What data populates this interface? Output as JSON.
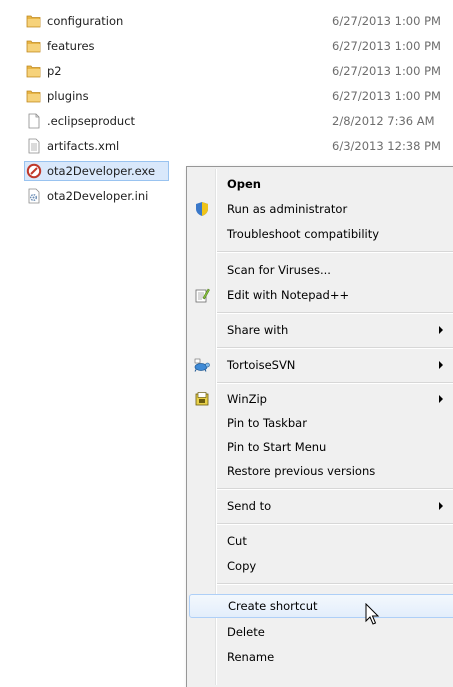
{
  "files": [
    {
      "name": "configuration",
      "date": "6/27/2013 1:00 PM",
      "icon": "folder-icon"
    },
    {
      "name": "features",
      "date": "6/27/2013 1:00 PM",
      "icon": "folder-icon"
    },
    {
      "name": "p2",
      "date": "6/27/2013 1:00 PM",
      "icon": "folder-icon"
    },
    {
      "name": "plugins",
      "date": "6/27/2013 1:00 PM",
      "icon": "folder-icon"
    },
    {
      "name": ".eclipseproduct",
      "date": "2/8/2012 7:36 AM",
      "icon": "blank-file-icon"
    },
    {
      "name": "artifacts.xml",
      "date": "6/3/2013 12:38 PM",
      "icon": "text-file-icon"
    },
    {
      "name": "ota2Developer.exe",
      "date": "",
      "icon": "exe-icon"
    },
    {
      "name": "ota2Developer.ini",
      "date": "",
      "icon": "settings-file-icon"
    }
  ],
  "selected_file_index": 6,
  "context_menu": {
    "open": "Open",
    "run_as_admin": "Run as administrator",
    "troubleshoot": "Troubleshoot compatibility",
    "scan_viruses": "Scan for Viruses...",
    "edit_notepad": "Edit with Notepad++",
    "share_with": "Share with",
    "tortoise_svn": "TortoiseSVN",
    "winzip": "WinZip",
    "pin_taskbar": "Pin to Taskbar",
    "pin_start": "Pin to Start Menu",
    "restore_versions": "Restore previous versions",
    "send_to": "Send to",
    "cut": "Cut",
    "copy": "Copy",
    "create_shortcut": "Create shortcut",
    "delete": "Delete",
    "rename": "Rename"
  },
  "highlighted_menu_item": "create_shortcut",
  "colors": {
    "selection": "#d9e8fb",
    "menu_background": "#f0f0f0",
    "folder": "#e8b545"
  }
}
